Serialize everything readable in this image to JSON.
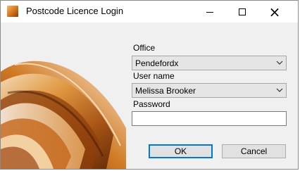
{
  "window": {
    "title": "Postcode Licence Login",
    "icon": "app-icon",
    "controls": {
      "minimize": "minimize-icon",
      "maximize": "maximize-icon",
      "close": "close-icon"
    }
  },
  "form": {
    "office_label": "Office",
    "office_value": "Pendefordx",
    "user_label": "User name",
    "user_value": "Melissa Brooker",
    "password_label": "Password",
    "password_value": ""
  },
  "buttons": {
    "ok": "OK",
    "cancel": "Cancel"
  },
  "colors": {
    "accent": "#0078d7",
    "art_dark": "#7a3408",
    "art_mid": "#d07a24",
    "art_light": "#f6d3a2"
  }
}
